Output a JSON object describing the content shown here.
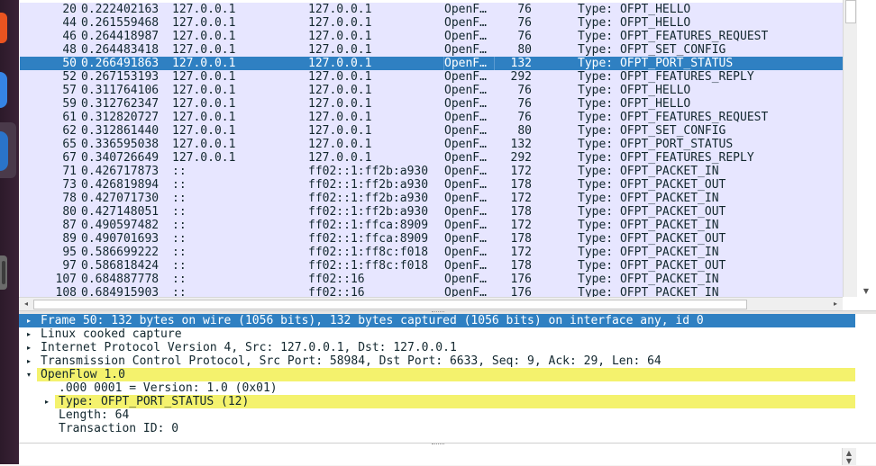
{
  "packet_list": {
    "rows": [
      {
        "no": "20",
        "time": "0.222402163",
        "src": "127.0.0.1",
        "dst": "127.0.0.1",
        "proto": "OpenF…",
        "len": "76",
        "info": "Type: OFPT_HELLO"
      },
      {
        "no": "44",
        "time": "0.261559468",
        "src": "127.0.0.1",
        "dst": "127.0.0.1",
        "proto": "OpenF…",
        "len": "76",
        "info": "Type: OFPT_HELLO"
      },
      {
        "no": "46",
        "time": "0.264418987",
        "src": "127.0.0.1",
        "dst": "127.0.0.1",
        "proto": "OpenF…",
        "len": "76",
        "info": "Type: OFPT_FEATURES_REQUEST"
      },
      {
        "no": "48",
        "time": "0.264483418",
        "src": "127.0.0.1",
        "dst": "127.0.0.1",
        "proto": "OpenF…",
        "len": "80",
        "info": "Type: OFPT_SET_CONFIG"
      },
      {
        "no": "50",
        "time": "0.266491863",
        "src": "127.0.0.1",
        "dst": "127.0.0.1",
        "proto": "OpenF…",
        "len": "132",
        "info": "Type: OFPT_PORT_STATUS",
        "selected": true
      },
      {
        "no": "52",
        "time": "0.267153193",
        "src": "127.0.0.1",
        "dst": "127.0.0.1",
        "proto": "OpenF…",
        "len": "292",
        "info": "Type: OFPT_FEATURES_REPLY"
      },
      {
        "no": "57",
        "time": "0.311764106",
        "src": "127.0.0.1",
        "dst": "127.0.0.1",
        "proto": "OpenF…",
        "len": "76",
        "info": "Type: OFPT_HELLO"
      },
      {
        "no": "59",
        "time": "0.312762347",
        "src": "127.0.0.1",
        "dst": "127.0.0.1",
        "proto": "OpenF…",
        "len": "76",
        "info": "Type: OFPT_HELLO"
      },
      {
        "no": "61",
        "time": "0.312820727",
        "src": "127.0.0.1",
        "dst": "127.0.0.1",
        "proto": "OpenF…",
        "len": "76",
        "info": "Type: OFPT_FEATURES_REQUEST"
      },
      {
        "no": "62",
        "time": "0.312861440",
        "src": "127.0.0.1",
        "dst": "127.0.0.1",
        "proto": "OpenF…",
        "len": "80",
        "info": "Type: OFPT_SET_CONFIG"
      },
      {
        "no": "65",
        "time": "0.336595038",
        "src": "127.0.0.1",
        "dst": "127.0.0.1",
        "proto": "OpenF…",
        "len": "132",
        "info": "Type: OFPT_PORT_STATUS"
      },
      {
        "no": "67",
        "time": "0.340726649",
        "src": "127.0.0.1",
        "dst": "127.0.0.1",
        "proto": "OpenF…",
        "len": "292",
        "info": "Type: OFPT_FEATURES_REPLY"
      },
      {
        "no": "71",
        "time": "0.426717873",
        "src": "::",
        "dst": "ff02::1:ff2b:a930",
        "proto": "OpenF…",
        "len": "172",
        "info": "Type: OFPT_PACKET_IN"
      },
      {
        "no": "73",
        "time": "0.426819894",
        "src": "::",
        "dst": "ff02::1:ff2b:a930",
        "proto": "OpenF…",
        "len": "178",
        "info": "Type: OFPT_PACKET_OUT"
      },
      {
        "no": "78",
        "time": "0.427071730",
        "src": "::",
        "dst": "ff02::1:ff2b:a930",
        "proto": "OpenF…",
        "len": "172",
        "info": "Type: OFPT_PACKET_IN"
      },
      {
        "no": "80",
        "time": "0.427148051",
        "src": "::",
        "dst": "ff02::1:ff2b:a930",
        "proto": "OpenF…",
        "len": "178",
        "info": "Type: OFPT_PACKET_OUT"
      },
      {
        "no": "87",
        "time": "0.490597482",
        "src": "::",
        "dst": "ff02::1:ffca:8909",
        "proto": "OpenF…",
        "len": "172",
        "info": "Type: OFPT_PACKET_IN"
      },
      {
        "no": "89",
        "time": "0.490701693",
        "src": "::",
        "dst": "ff02::1:ffca:8909",
        "proto": "OpenF…",
        "len": "178",
        "info": "Type: OFPT_PACKET_OUT"
      },
      {
        "no": "95",
        "time": "0.586699222",
        "src": "::",
        "dst": "ff02::1:ff8c:f018",
        "proto": "OpenF…",
        "len": "172",
        "info": "Type: OFPT_PACKET_IN"
      },
      {
        "no": "97",
        "time": "0.586818424",
        "src": "::",
        "dst": "ff02::1:ff8c:f018",
        "proto": "OpenF…",
        "len": "178",
        "info": "Type: OFPT_PACKET_OUT"
      },
      {
        "no": "107",
        "time": "0.684887778",
        "src": "::",
        "dst": "ff02::16",
        "proto": "OpenF…",
        "len": "176",
        "info": "Type: OFPT_PACKET_IN"
      },
      {
        "no": "108",
        "time": "0.684915903",
        "src": "::",
        "dst": "ff02::16",
        "proto": "OpenF…",
        "len": "176",
        "info": "Type: OFPT_PACKET_IN"
      }
    ]
  },
  "details": {
    "items": [
      {
        "text": "Frame 50: 132 bytes on wire (1056 bits), 132 bytes captured (1056 bits) on interface any, id 0",
        "arrow": "right",
        "indent": 0,
        "style": "sel"
      },
      {
        "text": "Linux cooked capture",
        "arrow": "right",
        "indent": 0,
        "style": ""
      },
      {
        "text": "Internet Protocol Version 4, Src: 127.0.0.1, Dst: 127.0.0.1",
        "arrow": "right",
        "indent": 0,
        "style": ""
      },
      {
        "text": "Transmission Control Protocol, Src Port: 58984, Dst Port: 6633, Seq: 9, Ack: 29, Len: 64",
        "arrow": "right",
        "indent": 0,
        "style": ""
      },
      {
        "text": "OpenFlow 1.0",
        "arrow": "down",
        "indent": 0,
        "style": "hl",
        "hl_width": 90
      },
      {
        "text": ".000 0001 = Version: 1.0 (0x01)",
        "arrow": "",
        "indent": 1,
        "style": ""
      },
      {
        "text": "Type: OFPT_PORT_STATUS (12)",
        "arrow": "right",
        "indent": 1,
        "style": "hl"
      },
      {
        "text": "Length: 64",
        "arrow": "",
        "indent": 1,
        "style": ""
      },
      {
        "text": "Transaction ID: 0",
        "arrow": "",
        "indent": 1,
        "style": ""
      }
    ]
  },
  "icons": {
    "expand_arrow": "▸",
    "collapse_arrow": "▾",
    "scroll_up": "▲",
    "scroll_down": "▼",
    "scroll_left": "◂",
    "scroll_right": "▸"
  },
  "colors": {
    "row_bg": "#e7e6ff",
    "selected_bg": "#2f80c2",
    "highlight_bg": "#f4f26d"
  }
}
